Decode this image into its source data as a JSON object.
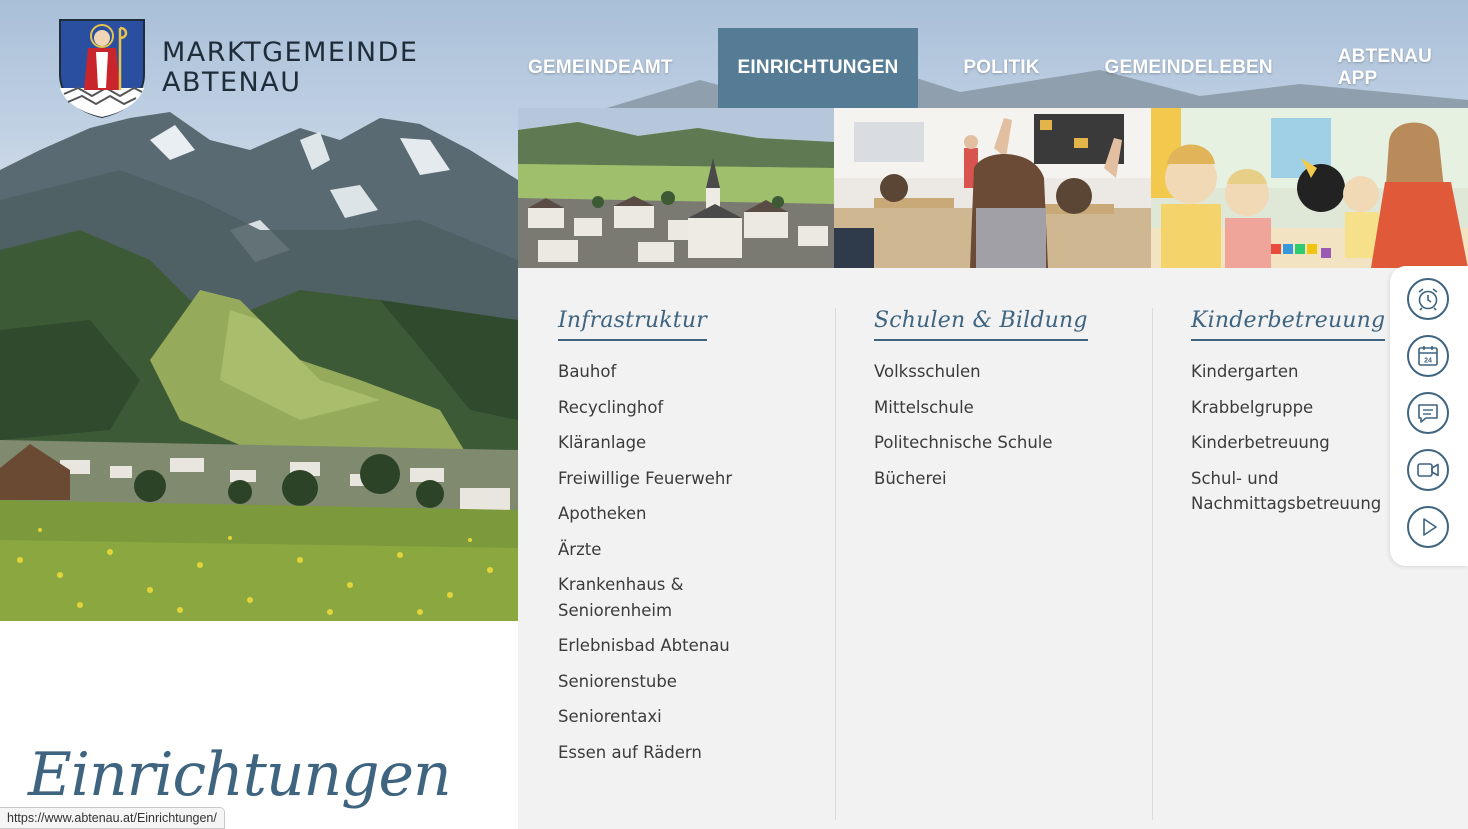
{
  "logo": {
    "line1": "MARKTGEMEINDE",
    "line2": "ABTENAU"
  },
  "nav": {
    "items": [
      {
        "label": "GEMEINDEAMT",
        "active": false
      },
      {
        "label": "EINRICHTUNGEN",
        "active": true
      },
      {
        "label": "POLITIK",
        "active": false
      },
      {
        "label": "GEMEINDELEBEN",
        "active": false
      },
      {
        "label": "ABTENAU APP",
        "active": false
      }
    ]
  },
  "mega_menu": {
    "columns": [
      {
        "heading": "Infrastruktur",
        "items": [
          "Bauhof",
          "Recyclinghof",
          "Kläranlage",
          "Freiwillige Feuerwehr",
          "Apotheken",
          "Ärzte",
          "Krankenhaus &",
          "Seniorenheim",
          "Erlebnisbad Abtenau",
          "Seniorenstube",
          "Seniorentaxi",
          "Essen auf Rädern"
        ]
      },
      {
        "heading": "Schulen & Bildung",
        "items": [
          "Volksschulen",
          "Mittelschule",
          "Politechnische Schule",
          "Bücherei"
        ]
      },
      {
        "heading": "Kinderbetreuung",
        "items": [
          "Kindergarten",
          "Krabbelgruppe",
          "Kinderbetreuung",
          "Schul- und",
          "Nachmittagsbetreuung"
        ]
      }
    ]
  },
  "quickbar": {
    "icons": [
      "alarm-clock-icon",
      "calendar-icon",
      "chat-icon",
      "video-camera-icon",
      "play-icon"
    ],
    "calendar_number": "24"
  },
  "page": {
    "title": "Einrichtungen"
  },
  "status_bar": {
    "url": "https://www.abtenau.at/Einrichtungen/"
  },
  "colors": {
    "accent": "#567b95",
    "heading": "#3e6480",
    "menu_bg": "#f2f2f2",
    "text": "#3b3b3b"
  }
}
